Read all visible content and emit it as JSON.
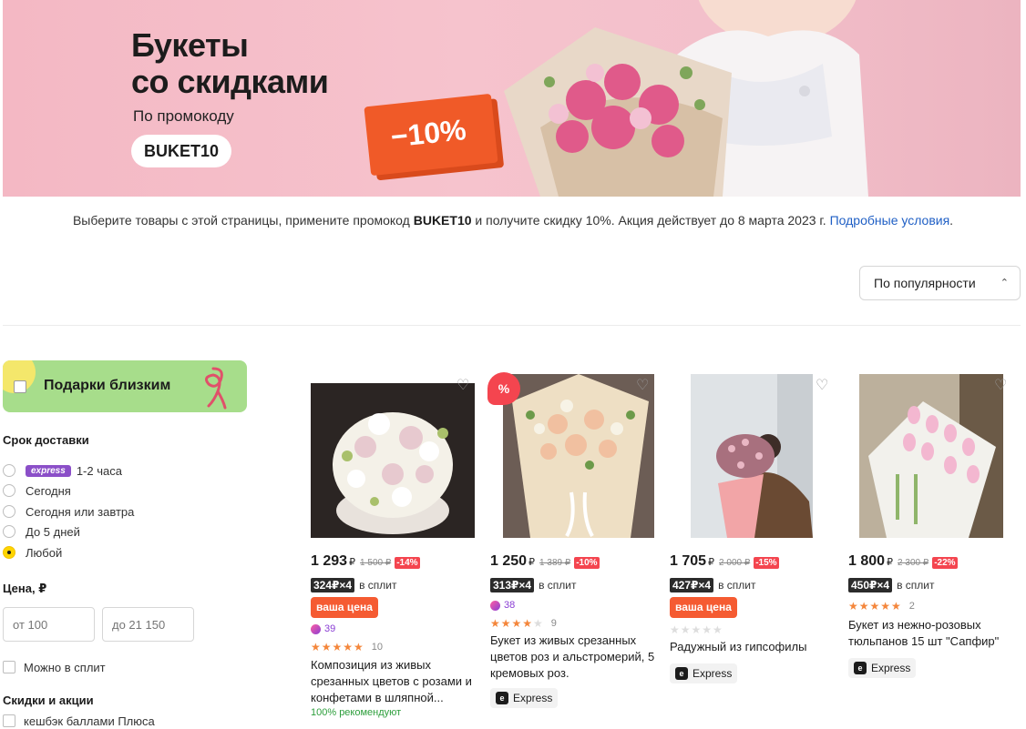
{
  "banner": {
    "title": "Букеты\nсо скидками",
    "subtitle": "По промокоду",
    "promo_code": "BUKET10",
    "discount": "−10%"
  },
  "notice": {
    "text_before": "Выберите товары с этой страницы, примените промокод ",
    "code": "BUKET10",
    "text_after": " и получите скидку 10%. Акция действует до 8 марта 2023 г. ",
    "link": "Подробные условия",
    "link_end": "."
  },
  "sort": {
    "selected": "По популярности"
  },
  "sidebar": {
    "gift_label": "Подарки близким",
    "delivery_title": "Срок доставки",
    "express_logo": "express",
    "delivery_options": [
      {
        "label": "1-2 часа",
        "selected": false
      },
      {
        "label": "Сегодня",
        "selected": false
      },
      {
        "label": "Сегодня или завтра",
        "selected": false
      },
      {
        "label": "До 5 дней",
        "selected": false
      },
      {
        "label": "Любой",
        "selected": true
      }
    ],
    "price_title": "Цена, ₽",
    "price_from_placeholder": "от 100",
    "price_to_placeholder": "до 21 150",
    "split_option": "Можно в сплит",
    "discounts_title": "Скидки и акции",
    "cashback_option": "кешбэк баллами Плюса"
  },
  "products": [
    {
      "price": "1 293",
      "currency": "₽",
      "old_price": "1 500 ₽",
      "discount": "-14%",
      "split_badge": "324₽×4",
      "split_text": "в сплит",
      "your_price": "ваша цена",
      "plus_points": "39",
      "rating": 5,
      "reviews": "10",
      "title": "Композиция из живых срезанных цветов с розами и конфетами в шляпной...",
      "recommend": "100% рекомендуют"
    },
    {
      "price": "1 250",
      "currency": "₽",
      "old_price": "1 389 ₽",
      "discount": "-10%",
      "sale_badge": "%",
      "split_badge": "313₽×4",
      "split_text": "в сплит",
      "plus_points": "38",
      "rating": 4.5,
      "reviews": "9",
      "title": "Букет из живых срезанных цветов роз и альстромерий, 5 кремовых роз.",
      "express": "Express"
    },
    {
      "price": "1 705",
      "currency": "₽",
      "old_price": "2 000 ₽",
      "discount": "-15%",
      "split_badge": "427₽×4",
      "split_text": "в сплит",
      "your_price": "ваша цена",
      "rating": 0,
      "title": "Радужный из гипсофилы",
      "express": "Express"
    },
    {
      "price": "1 800",
      "currency": "₽",
      "old_price": "2 300 ₽",
      "discount": "-22%",
      "split_badge": "450₽×4",
      "split_text": "в сплит",
      "rating": 5,
      "reviews": "2",
      "title": "Букет из нежно-розовых тюльпанов 15 шт \"Сапфир\"",
      "express": "Express"
    }
  ],
  "colors": {
    "accent_orange": "#f05a28",
    "discount_red": "#f4454f",
    "link_blue": "#1f5fc5",
    "gift_green": "#a7dd8b",
    "radio_yellow": "#ffd500",
    "plus_purple": "#8a3ed4"
  }
}
